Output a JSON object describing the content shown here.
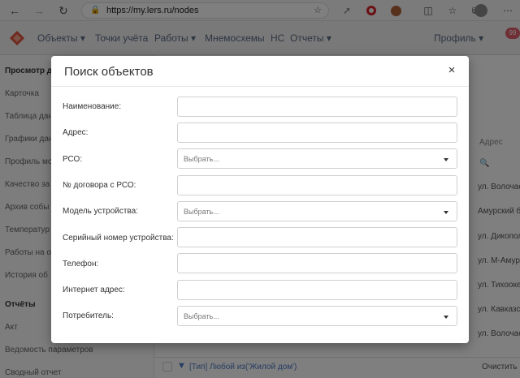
{
  "browser": {
    "url": "https://my.lers.ru/nodes"
  },
  "header": {
    "menu": [
      "Объекты ▾",
      "Точки учёта",
      "Работы ▾",
      "Мнемосхемы",
      "НС",
      "Отчеты ▾"
    ],
    "profile": "Профиль ▾",
    "badge": "99"
  },
  "sidebar": {
    "section1": "Просмотр д",
    "items1": [
      "Карточка",
      "Таблица дан",
      "Графики дан",
      "Профиль мо",
      "Качество за",
      "Архив собы",
      "Температур",
      "Работы на об",
      "История об"
    ],
    "section2": "Отчёты",
    "items2": [
      "Акт",
      "Ведомость параметров",
      "Сводный отчет"
    ]
  },
  "main": {
    "column_header": "Адрес",
    "addresses": [
      "ул. Волочае",
      "Амурский б",
      "ул. Дикопол",
      "ул. М-Амур",
      "ул. Тихооке",
      "ул. Кавказс",
      "ул. Волочае"
    ],
    "filter_text": "[Тип] Любой из('Жилой дом')",
    "clear_label": "Очистить"
  },
  "modal": {
    "title": "Поиск объектов",
    "close_label": "×",
    "fields": [
      {
        "label": "Наименование:",
        "type": "input",
        "value": ""
      },
      {
        "label": "Адрес:",
        "type": "input",
        "value": ""
      },
      {
        "label": "РСО:",
        "type": "select",
        "value": "Выбрать..."
      },
      {
        "label": "№ договора с РСО:",
        "type": "input",
        "value": ""
      },
      {
        "label": "Модель устройства:",
        "type": "select",
        "value": "Выбрать..."
      },
      {
        "label": "Серийный номер устройства:",
        "type": "input",
        "value": ""
      },
      {
        "label": "Телефон:",
        "type": "input",
        "value": ""
      },
      {
        "label": "Интернет адрес:",
        "type": "input",
        "value": ""
      },
      {
        "label": "Потребитель:",
        "type": "select",
        "value": "Выбрать..."
      }
    ]
  },
  "colors": {
    "accent": "#4a78c2",
    "overlay": "#000000",
    "badge": "#e05c6a"
  }
}
